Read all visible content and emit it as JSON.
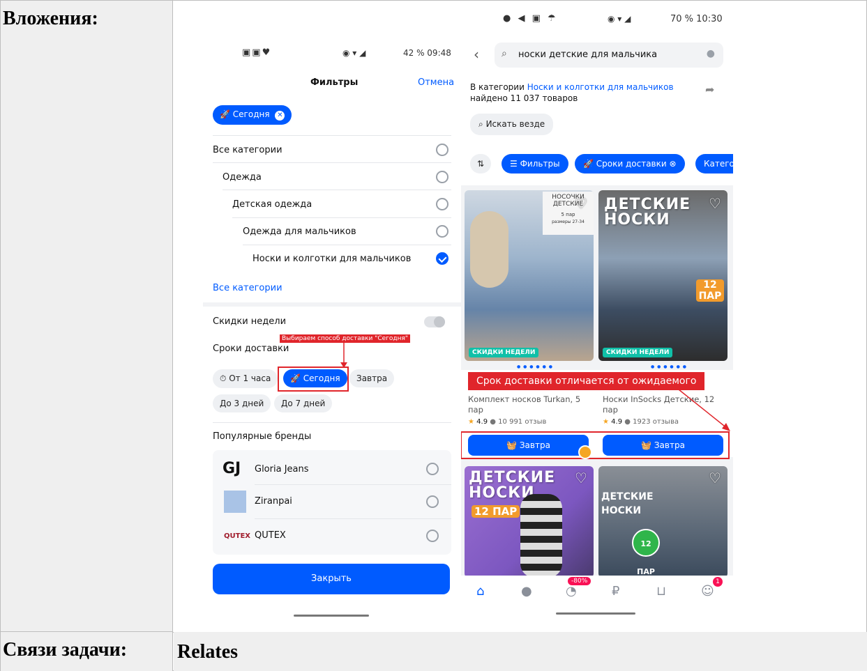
{
  "table": {
    "attachments_label": "Вложения:",
    "relations_label": "Связи задачи:",
    "relations_value": "Relates"
  },
  "left_phone": {
    "status_time": "42 % 09:48",
    "title": "Фильтры",
    "cancel": "Отмена",
    "active_chip": "Сегодня",
    "categories": [
      "Все категории",
      "Одежда",
      "Детская одежда",
      "Одежда для мальчиков",
      "Носки и колготки для мальчиков"
    ],
    "all_categories_link": "Все категории",
    "discounts_label": "Скидки недели",
    "delivery_label": "Сроки доставки",
    "annotation": "Выбираем способ доставки \"Сегодня\"",
    "delivery_options": [
      "От 1 часа",
      "Сегодня",
      "Завтра",
      "До 3 дней",
      "До 7 дней"
    ],
    "brands_label": "Популярные бренды",
    "brands": [
      {
        "logo": "GJ",
        "name": "Gloria Jeans"
      },
      {
        "logo": "",
        "name": "Ziranpai"
      },
      {
        "logo": "QUTEX",
        "name": "QUTEX"
      }
    ],
    "close_button": "Закрыть"
  },
  "right_phone": {
    "status_time": "70 % 10:30",
    "search_query": "носки детские для мальчика",
    "category_prefix": "В категории ",
    "category_link": "Носки и колготки для мальчиков",
    "found_text": "найдено 11 037 товаров",
    "search_everywhere": "Искать везде",
    "chips": [
      "Фильтры",
      "Сроки доставки",
      "Катего"
    ],
    "products": [
      {
        "img_text_top": "НОСОЧКИ ДЕТСКИЕ",
        "img_pairs": "5 пар",
        "img_sizes": "размеры 27-34",
        "badge": "СКИДКИ НЕДЕЛИ",
        "name": "Комплект носков Turkan, 5 пар",
        "rating": "4.9",
        "reviews": "10 991 отзыв",
        "button": "Завтра"
      },
      {
        "img_text_top": "ДЕТСКИЕ НОСКИ",
        "img_pairs": "12 ПАР",
        "badge": "СКИДКИ НЕДЕЛИ",
        "name": "Носки InSocks Детские, 12 пар",
        "rating": "4.9",
        "reviews": "1923 отзыва",
        "button": "Завтра"
      },
      {
        "img_text_top": "ДЕТСКИЕ НОСКИ",
        "img_pairs": "12 ПАР"
      },
      {
        "img_text_top": "ДЕТСКИЕ НОСКИ",
        "img_pairs": "12 ПАР"
      }
    ],
    "annotation": "Срок доставки отличается от ожидаемого",
    "nav_badge_discount": "-80%",
    "nav_badge_cart": "1"
  },
  "colors": {
    "brand_blue": "#005bff",
    "annotation_red": "#e0252b",
    "table_grey": "#efefef"
  }
}
